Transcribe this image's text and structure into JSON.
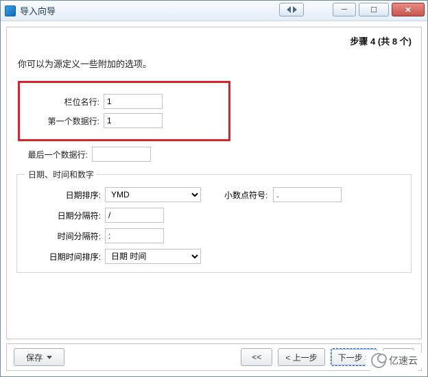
{
  "window": {
    "title": "导入向导"
  },
  "step": "步骤 4 (共 8 个)",
  "description": "你可以为源定义一些附加的选项。",
  "fields": {
    "col_name_row_label": "栏位名行:",
    "col_name_row_value": "1",
    "first_data_row_label": "第一个数据行:",
    "first_data_row_value": "1",
    "last_data_row_label": "最后一个数据行:",
    "last_data_row_value": ""
  },
  "group": {
    "legend": "日期、时间和数字",
    "date_order_label": "日期排序:",
    "date_order_value": "YMD",
    "date_sep_label": "日期分隔符:",
    "date_sep_value": "/",
    "time_sep_label": "时间分隔符:",
    "time_sep_value": ":",
    "datetime_order_label": "日期时间排序:",
    "datetime_order_value": "日期 时间",
    "decimal_label": "小数点符号:",
    "decimal_value": "."
  },
  "buttons": {
    "save": "保存",
    "first": "<<",
    "prev": "< 上一步",
    "next": "下一步 >",
    "last": ">>"
  },
  "watermark": "亿速云"
}
